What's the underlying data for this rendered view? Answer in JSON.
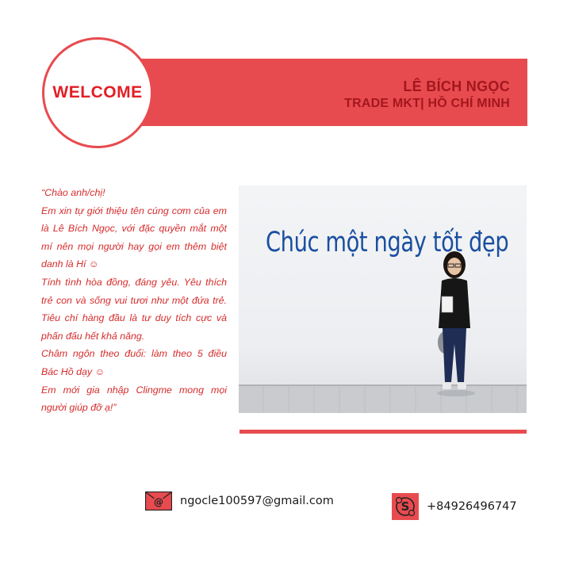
{
  "header": {
    "welcome_label": "WELCOME",
    "name": "LÊ BÍCH NGỌC",
    "role": "TRADE MKT| HỒ CHÍ MINH"
  },
  "intro": {
    "paragraphs": [
      "“Chào anh/chị!",
      "Em xin tự giới thiệu tên cúng cơm của em là Lê Bích Ngọc, với đặc quyền mắt một mí nên mọi người hay gọi em thêm biệt danh là Hí ☺",
      "Tính tình hòa đồng, đáng yêu. Yêu thích trẻ con và sống vui tươi như một đứa trẻ. Tiêu chí hàng đầu là tư duy tích cực và phấn đấu hết khả năng.",
      "Châm ngôn theo đuổi: làm theo 5 điều Bác Hồ dạy ☺",
      "Em mới gia nhập Clingme mong mọi người giúp đỡ ạ!”"
    ]
  },
  "photo": {
    "slogan": "Chúc một ngày tốt đẹp"
  },
  "contacts": {
    "email": "ngocle100597@gmail.com",
    "email_icon": "envelope-at-icon",
    "phone": "+84926496747",
    "phone_icon": "skype-icon"
  },
  "colors": {
    "accent": "#e84b4f",
    "welcome_text": "#e31e25",
    "name_text": "#a3171e",
    "intro_text": "#d62b2b",
    "slogan_text": "#1a4fa0"
  }
}
